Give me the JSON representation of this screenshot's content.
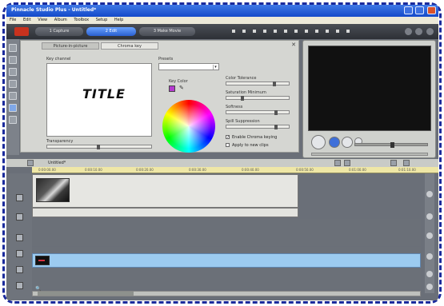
{
  "window": {
    "title": "Pinnacle Studio Plus - Untitled*",
    "controls": [
      "minimize",
      "maximize",
      "close"
    ]
  },
  "menu": [
    "File",
    "Edit",
    "View",
    "Album",
    "Toolbox",
    "Setup",
    "Help"
  ],
  "mode_tabs": [
    "1 Capture",
    "2 Edit",
    "3 Make Movie"
  ],
  "active_mode_tab": "2 Edit",
  "editor": {
    "tabs": [
      "Picture-in-picture",
      "Chroma key"
    ],
    "active_tab": "Chroma key",
    "key_channel_label": "Key channel",
    "preview_title": "TITLE",
    "transparency_label": "Transparency",
    "presets_label": "Presets",
    "presets_value": "",
    "key_color_label": "Key Color",
    "key_color": "#b53ad0",
    "sliders": [
      "Color Tolerance",
      "Saturation Minimum",
      "Softness",
      "Spill Suppression"
    ],
    "checkboxes": [
      {
        "label": "Enable Chroma keying",
        "checked": true
      },
      {
        "label": "Apply to new clips",
        "checked": false
      }
    ]
  },
  "timeline": {
    "project_name": "Untitled*",
    "ruler_labels": [
      "0:00:00.00",
      "0:00:10.00",
      "0:00:20.00",
      "0:00:30.00",
      "0:00:40.00",
      "0:00:50.00",
      "0:01:00.00",
      "0:01:10.00"
    ]
  },
  "colors": {
    "accent_tab": "#2a5fd0",
    "title_track": "#9ccbf0",
    "ruler": "#efe7a6",
    "frame_dash": "#1a2a9c"
  }
}
